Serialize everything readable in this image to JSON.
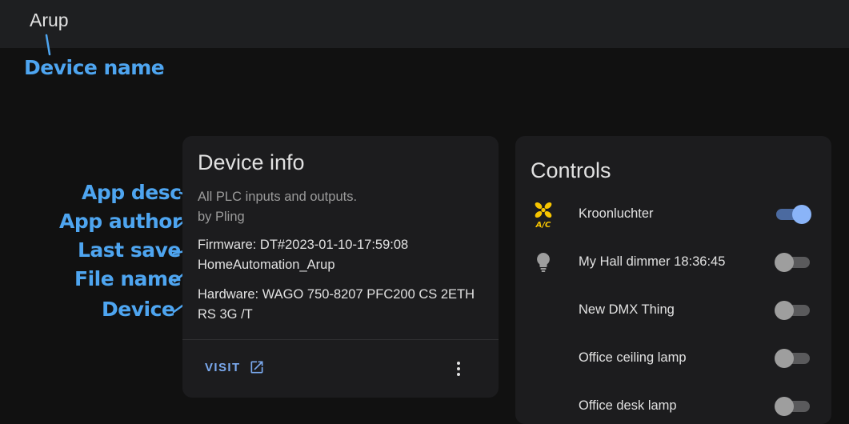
{
  "header": {
    "title": "Arup"
  },
  "annotations": {
    "device_name": "Device name",
    "app_desc": "App desc",
    "app_author": "App author",
    "last_save": "Last save",
    "file_name": "File name",
    "device": "Device"
  },
  "device_info": {
    "title": "Device info",
    "description": "All PLC inputs and outputs.",
    "author": "by Pling",
    "firmware": "Firmware: DT#2023-01-10-17:59:08",
    "file_name": "HomeAutomation_Arup",
    "hardware": "Hardware: WAGO 750-8207 PFC200 CS 2ETH RS 3G /T",
    "visit_label": "VISIT"
  },
  "controls": {
    "title": "Controls",
    "items": [
      {
        "label": "Kroonluchter",
        "icon": "ac-fan-icon",
        "on": true
      },
      {
        "label": "My Hall dimmer 18:36:45",
        "icon": "lightbulb-icon",
        "on": false
      },
      {
        "label": "New DMX Thing",
        "icon": "",
        "on": false
      },
      {
        "label": "Office ceiling lamp",
        "icon": "",
        "on": false
      },
      {
        "label": "Office desk lamp",
        "icon": "",
        "on": false
      }
    ]
  },
  "colors": {
    "accent": "#4ea5f0",
    "toggle_on": "#8ab4f8",
    "icon_ac": "#f7c500",
    "card_bg": "#1c1c1e"
  }
}
